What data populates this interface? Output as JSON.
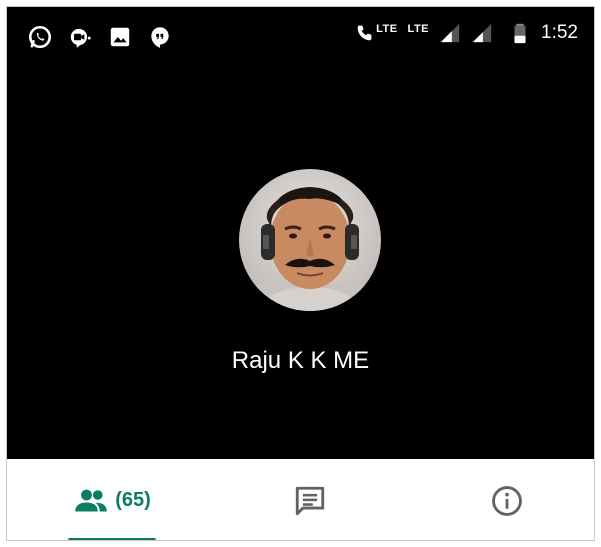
{
  "status_bar": {
    "left_icons": [
      "whatsapp-icon",
      "hangouts-video-icon",
      "image-icon",
      "hangouts-icon"
    ],
    "volte_label": "LTE",
    "network_label": "LTE",
    "time": "1:52"
  },
  "call": {
    "contact_name": "Raju K K ME"
  },
  "tabs": {
    "participants_count": "(65)",
    "participants_icon": "people-icon",
    "chat_icon": "chat-icon",
    "info_icon": "info-icon",
    "active_color": "#0b7d62",
    "inactive_color": "#5f6368"
  },
  "colors": {
    "background_dark": "#000000",
    "tab_bar_background": "#ffffff",
    "accent": "#0b7d62"
  }
}
